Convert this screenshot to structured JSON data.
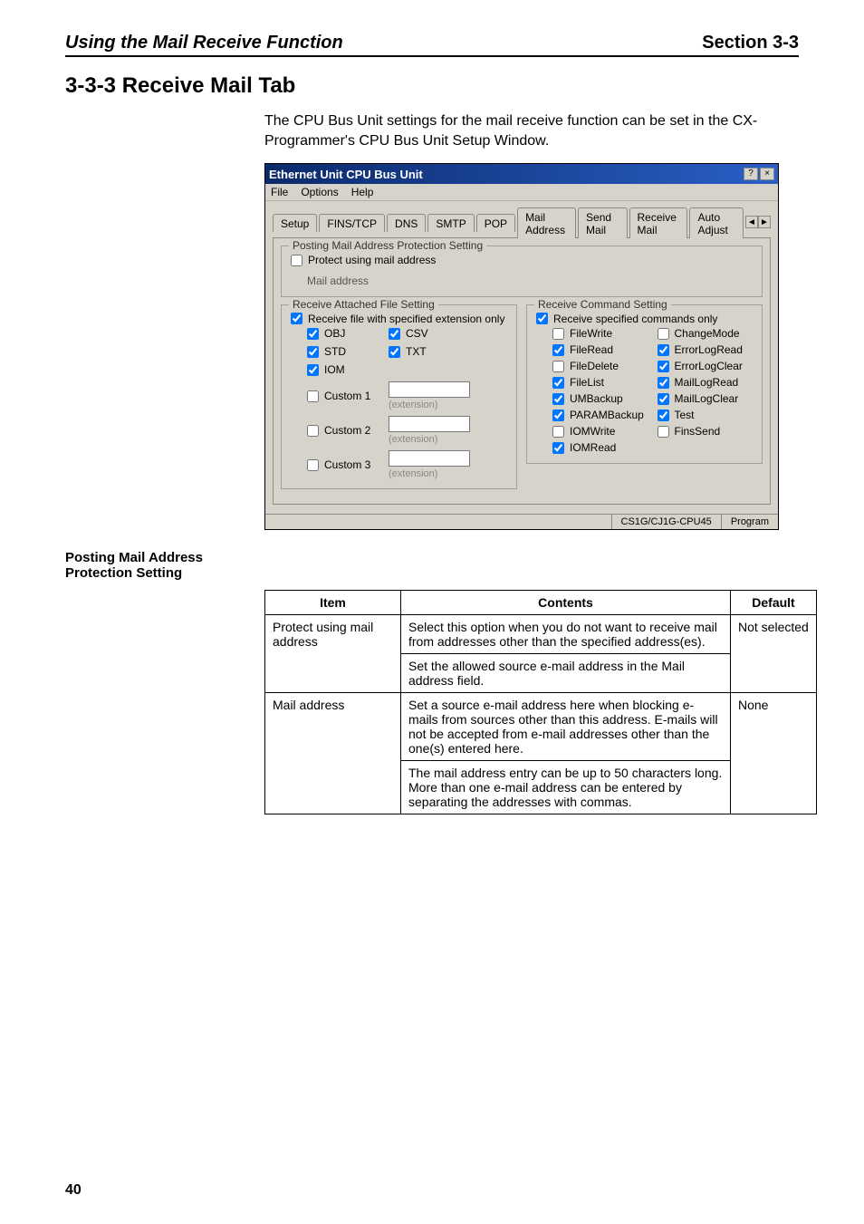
{
  "header": {
    "left": "Using the Mail Receive Function",
    "right": "Section 3-3"
  },
  "section_title": "3-3-3    Receive Mail Tab",
  "intro": "The CPU Bus Unit settings for the mail receive function can be set in the CX-Programmer's CPU Bus Unit Setup Window.",
  "dlg": {
    "title": "Ethernet Unit CPU Bus Unit",
    "menu": [
      "File",
      "Options",
      "Help"
    ],
    "tabs": [
      "Setup",
      "FINS/TCP",
      "DNS",
      "SMTP",
      "POP",
      "Mail Address",
      "Send Mail",
      "Receive Mail",
      "Auto Adjust"
    ],
    "active_tab": 7,
    "posting": {
      "legend": "Posting Mail Address Protection Setting",
      "protect": "Protect using mail address",
      "mail_addr_label": "Mail address"
    },
    "attach": {
      "legend": "Receive Attached File Setting",
      "top": "Receive file with specified extension only",
      "rows": [
        {
          "name": "OBJ",
          "c": true
        },
        {
          "name": "CSV",
          "c": true
        },
        {
          "name": "STD",
          "c": true
        },
        {
          "name": "TXT",
          "c": true
        },
        {
          "name": "IOM",
          "c": true
        },
        {
          "name": "",
          "c": false
        },
        {
          "name": "Custom 1",
          "c": false,
          "ext": "(extension)"
        },
        {
          "name": "Custom 2",
          "c": false,
          "ext": "(extension)"
        },
        {
          "name": "Custom 3",
          "c": false,
          "ext": "(extension)"
        }
      ]
    },
    "cmd": {
      "legend": "Receive Command Setting",
      "top": "Receive specified commands only",
      "items": [
        {
          "label": "FileWrite",
          "c": false
        },
        {
          "label": "ChangeMode",
          "c": false
        },
        {
          "label": "FileRead",
          "c": true
        },
        {
          "label": "ErrorLogRead",
          "c": true
        },
        {
          "label": "FileDelete",
          "c": false
        },
        {
          "label": "ErrorLogClear",
          "c": true
        },
        {
          "label": "FileList",
          "c": true
        },
        {
          "label": "MailLogRead",
          "c": true
        },
        {
          "label": "UMBackup",
          "c": true
        },
        {
          "label": "MailLogClear",
          "c": true
        },
        {
          "label": "PARAMBackup",
          "c": true
        },
        {
          "label": "Test",
          "c": true
        },
        {
          "label": "IOMWrite",
          "c": false
        },
        {
          "label": "FinsSend",
          "c": false
        },
        {
          "label": "IOMRead",
          "c": true
        }
      ]
    },
    "status": {
      "left": "CS1G/CJ1G-CPU45",
      "right": "Program"
    }
  },
  "subhead": "Posting Mail Address Protection Setting",
  "table": {
    "head": [
      "Item",
      "Contents",
      "Default"
    ],
    "rows": [
      {
        "item": "Protect using mail address",
        "c1": "Select this option when you do not want to receive mail from addresses other than the specified address(es).",
        "c2": "Set the allowed source e-mail address in the Mail address field.",
        "def": "Not selected"
      },
      {
        "item": "Mail address",
        "c1": "Set a source e-mail address here when blocking e-mails from sources other than this address. E-mails will not be accepted from e-mail addresses other than the one(s) entered here.",
        "c2": "The mail address entry can be up to 50 characters long. More than one e-mail address can be entered by separating the addresses with commas.",
        "def": "None"
      }
    ]
  },
  "page_number": "40"
}
